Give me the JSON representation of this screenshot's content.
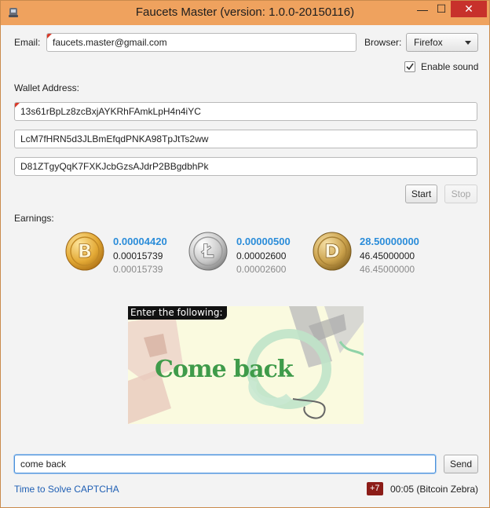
{
  "window": {
    "title": "Faucets Master (version: 1.0.0-20150116)",
    "minimize_glyph": "—",
    "maximize_glyph": "☐",
    "close_glyph": "✕"
  },
  "form": {
    "email_label": "Email:",
    "email_value": "faucets.master@gmail.com",
    "browser_label": "Browser:",
    "browser_value": "Firefox",
    "enable_sound_label": "Enable sound",
    "enable_sound_checked": true,
    "wallet_label": "Wallet Address:",
    "wallets": [
      "13s61rBpLz8zcBxjAYKRhFAmkLpH4n4iYC",
      "LcM7fHRN5d3JLBmEfqdPNKA98TpJtTs2ww",
      "D81ZTgyQqK7FXKJcbGzsAJdrP2BBgdbhPk"
    ],
    "start_label": "Start",
    "stop_label": "Stop"
  },
  "earnings": {
    "label": "Earnings:",
    "coins": [
      {
        "icon": "bitcoin-icon",
        "symbol": "B",
        "main": "0.00004420",
        "sub": "0.00015739",
        "sub2": "0.00015739"
      },
      {
        "icon": "litecoin-icon",
        "symbol": "Ł",
        "main": "0.00000500",
        "sub": "0.00002600",
        "sub2": "0.00002600"
      },
      {
        "icon": "dogecoin-icon",
        "symbol": "D",
        "main": "28.50000000",
        "sub": "46.45000000",
        "sub2": "46.45000000"
      }
    ]
  },
  "captcha": {
    "prompt": "Enter the following:",
    "text": "Come back",
    "answer": "come back",
    "send_label": "Send"
  },
  "status": {
    "message": "Time to Solve CAPTCHA",
    "badge": "+7",
    "timer": "00:05 (Bitcoin Zebra)"
  },
  "colors": {
    "titlebar": "#efa25e",
    "accent_blue": "#2a8cd9",
    "close_red": "#c7312b"
  }
}
